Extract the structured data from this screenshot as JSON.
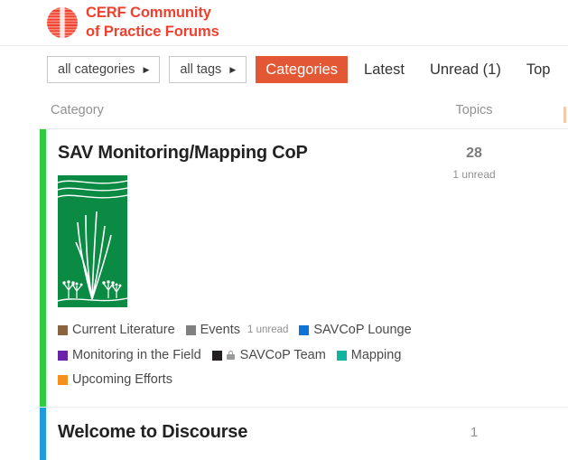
{
  "header": {
    "brand_line1": "CERF Community",
    "brand_line2": "of Practice Forums",
    "brand_color": "#ef4130",
    "logo_icon": "cerf-circle-logo"
  },
  "nav": {
    "category_filter": {
      "label": "all categories",
      "caret": "▶"
    },
    "tag_filter": {
      "label": "all tags",
      "caret": "▶"
    },
    "active_color": "#e45735",
    "links": [
      {
        "label": "Categories",
        "active": true
      },
      {
        "label": "Latest",
        "active": false
      },
      {
        "label": "Unread (1)",
        "active": false
      },
      {
        "label": "Top",
        "active": false
      }
    ]
  },
  "table": {
    "headers": {
      "category": "Category",
      "topics": "Topics",
      "extra": ""
    },
    "rows": [
      {
        "title": "SAV Monitoring/Mapping CoP",
        "stripe_color": "#2ecc40",
        "topics": "28",
        "unread": "1 unread",
        "logo": "sav-seagrass-banner",
        "subcategories": [
          {
            "label": "Current Literature",
            "color": "#8a6340",
            "unread": "",
            "locked": false
          },
          {
            "label": "Events",
            "color": "#808080",
            "unread": "1 unread",
            "locked": false
          },
          {
            "label": "SAVCoP Lounge",
            "color": "#0b74d6",
            "unread": "",
            "locked": false
          },
          {
            "label": "Monitoring in the Field",
            "color": "#6a23a8",
            "unread": "",
            "locked": false
          },
          {
            "label": "SAVCoP Team",
            "color": "#231f20",
            "unread": "",
            "locked": true
          },
          {
            "label": "Mapping",
            "color": "#12b2a0",
            "unread": "",
            "locked": false
          },
          {
            "label": "Upcoming Efforts",
            "color": "#f5901d",
            "unread": "",
            "locked": false
          }
        ]
      },
      {
        "title": "Welcome to Discourse",
        "stripe_color": "#1e9ce0",
        "topics": "1",
        "unread": "",
        "logo": "",
        "subcategories": []
      }
    ]
  }
}
